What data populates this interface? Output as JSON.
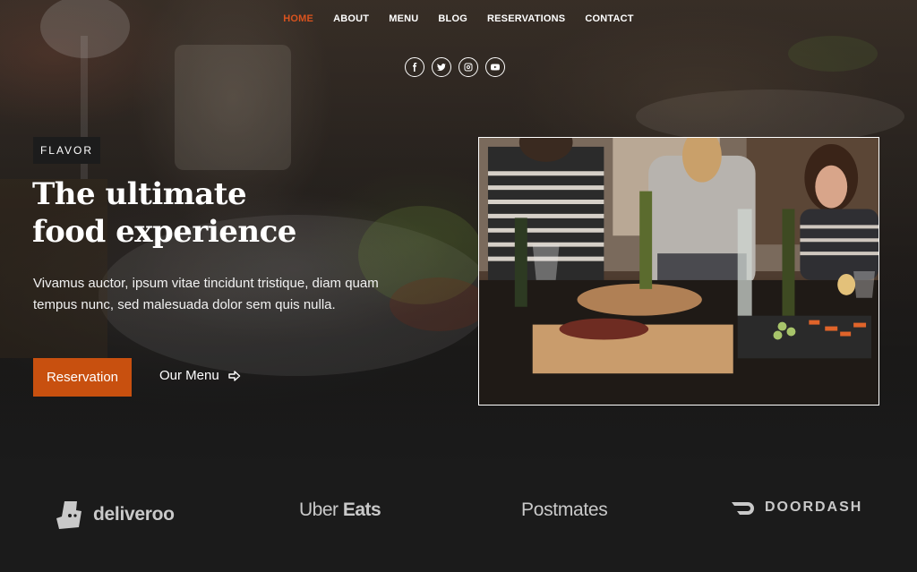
{
  "nav": {
    "items": [
      {
        "label": "HOME",
        "active": true
      },
      {
        "label": "ABOUT"
      },
      {
        "label": "MENU"
      },
      {
        "label": "BLOG"
      },
      {
        "label": "RESERVATIONS"
      },
      {
        "label": "CONTACT"
      }
    ],
    "active_color": "#d9531e"
  },
  "socials": [
    "facebook-icon",
    "twitter-icon",
    "instagram-icon",
    "youtube-icon"
  ],
  "hero": {
    "badge": "FLAVOR",
    "title": "The ultimate food experience",
    "description": "Vivamus auctor, ipsum vitae tincidunt tristique, diam quam tempus nunc, sed malesuada dolor sem quis nulla.",
    "reserve_label": "Reservation",
    "menu_label": "Our Menu",
    "accent": "#c8500f"
  },
  "partners": {
    "deliveroo": "deliveroo",
    "uber_a": "Uber",
    "uber_b": "Eats",
    "postmates": "Postmates",
    "doordash": "DOORDASH"
  }
}
